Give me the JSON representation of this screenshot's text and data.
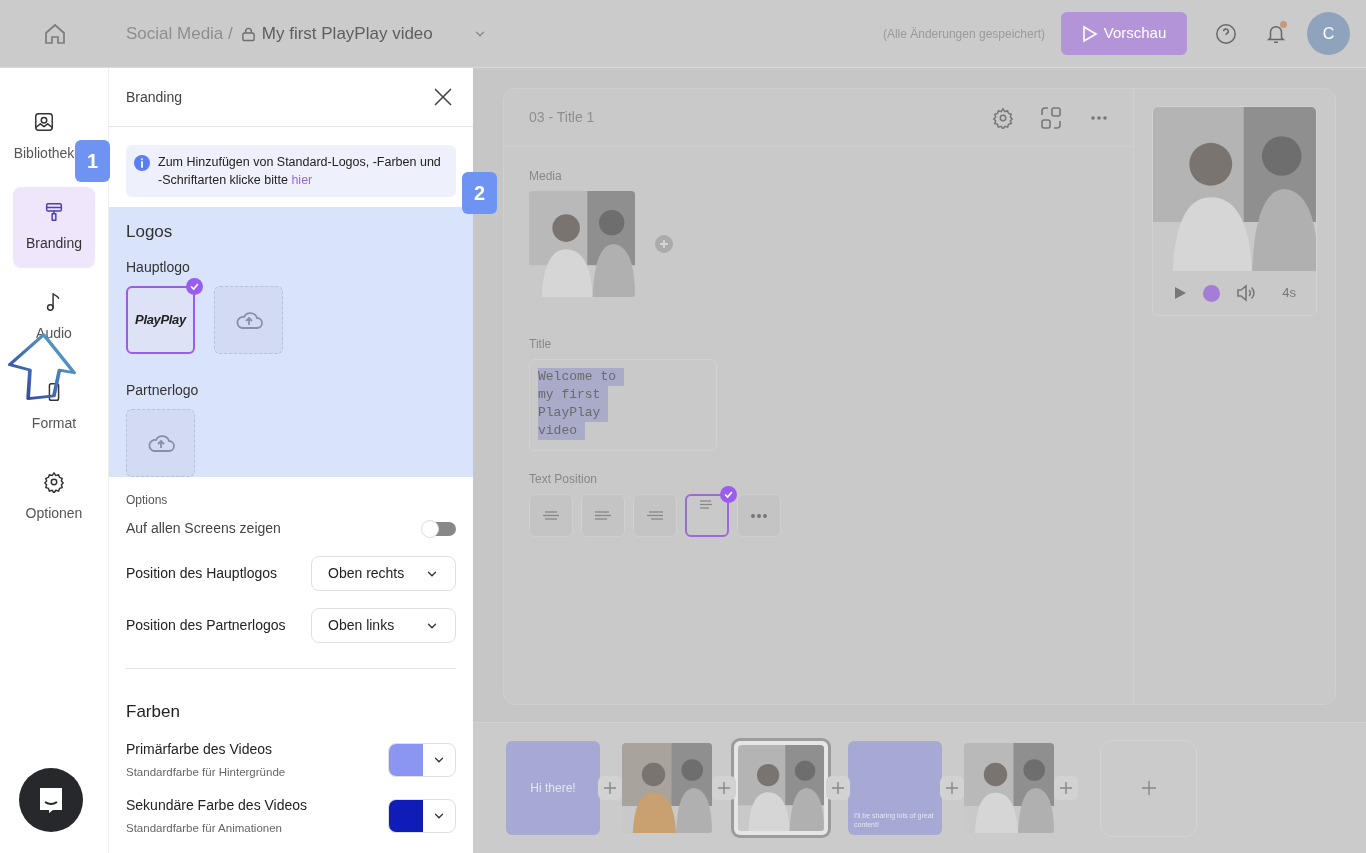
{
  "topbar": {
    "breadcrumb": "Social Media /",
    "project_title": "My first PlayPlay video",
    "save_status": "(Alle Änderungen gespeichert)",
    "preview_button": "Vorschau",
    "avatar": "C",
    "has_notification": true
  },
  "nav": [
    {
      "label": "Bibliothek",
      "kind": "library",
      "selected": false
    },
    {
      "label": "Branding",
      "kind": "branding",
      "selected": true
    },
    {
      "label": "Audio",
      "kind": "audio",
      "selected": false
    },
    {
      "label": "Format",
      "kind": "format",
      "selected": false
    },
    {
      "label": "Optionen",
      "kind": "options",
      "selected": false
    }
  ],
  "annotations": [
    {
      "label": "1"
    },
    {
      "label": "2"
    }
  ],
  "panel": {
    "title": "Branding",
    "info": "Zum Hinzufügen von Standard-Logos, -Farben und -Schriftarten klicke bitte",
    "info_link": "hier",
    "logos_heading": "Logos",
    "main_logo_label": "Hauptlogo",
    "main_logos": [
      {
        "kind": "logo",
        "text": "PlayPlay",
        "selected": true
      },
      {
        "kind": "upload",
        "selected": false
      }
    ],
    "partner_logo_label": "Partnerlogo",
    "options_heading": "Options",
    "show_all_label": "Auf allen Screens zeigen",
    "show_all_on": false,
    "selects": [
      {
        "label": "Position des Hauptlogos",
        "value": "Oben rechts"
      },
      {
        "label": "Position des Partnerlogos",
        "value": "Oben links"
      }
    ],
    "colors_heading": "Farben",
    "colors": [
      {
        "label": "Primärfarbe des Videos",
        "hint": "Standardfarbe für Hintergründe",
        "color": "#8a96f2"
      },
      {
        "label": "Sekundäre Farbe des Videos",
        "hint": "Standardfarbe für Animationen",
        "color": "#0f1cb8"
      }
    ]
  },
  "editor": {
    "scene_title": "03 - Title 1",
    "media_label": "Media",
    "title_label": "Title",
    "title_lines": [
      "Welcome to",
      "my first",
      "PlayPlay",
      "video"
    ],
    "text_position_label": "Text Position",
    "text_positions": [
      {
        "kind": "center",
        "selected": false
      },
      {
        "kind": "left",
        "selected": false
      },
      {
        "kind": "right",
        "selected": false
      },
      {
        "kind": "top-left",
        "selected": true
      },
      {
        "kind": "more",
        "selected": false
      }
    ],
    "duration": "4s"
  },
  "timeline": [
    {
      "kind": "color",
      "text": "Hi there!",
      "selected": false
    },
    {
      "kind": "picture",
      "selected": false
    },
    {
      "kind": "picture",
      "selected": true
    },
    {
      "kind": "color",
      "text": "I'll be sharing lots of great content!",
      "selected": false
    },
    {
      "kind": "picture",
      "selected": false
    }
  ]
}
